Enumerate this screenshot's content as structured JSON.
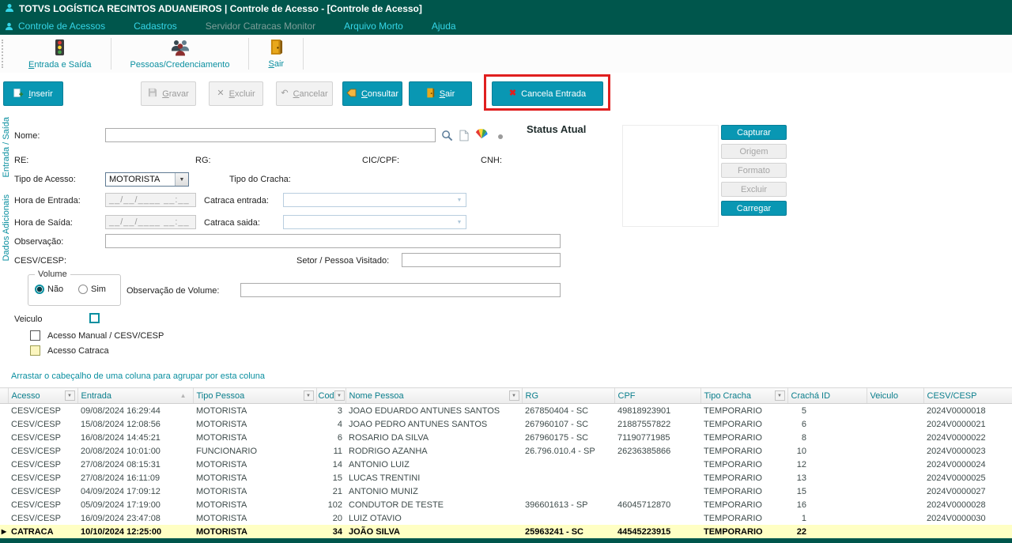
{
  "colors": {
    "titlebar": "#00564C",
    "accent_teal": "#0997B3",
    "menu_cyan": "#35D6E8",
    "highlight_row": "#FFFFC4",
    "attention_red": "#E01F1F"
  },
  "icons": {
    "filter_arrow": "▼",
    "sort_asc": "▲",
    "row_marker": "▶",
    "dropdown_arrow": "▼",
    "excluir_glyph": "✕",
    "cancelar_glyph": "↶",
    "cancela_entrada_glyph": "✖"
  },
  "title_bar": {
    "title": "TOTVS LOGÍSTICA RECINTOS ADUANEIROS | Controle de Acesso - [Controle de Acesso]"
  },
  "menu": {
    "items": [
      {
        "label": "Controle de Acessos"
      },
      {
        "label": "Cadastros"
      },
      {
        "label": "Servidor Catracas Monitor"
      },
      {
        "label": "Arquivo Morto"
      },
      {
        "label": "Ajuda"
      }
    ]
  },
  "toolbar": {
    "entrada_saida": "Entrada e Saída",
    "pessoas": "Pessoas/Credenciamento",
    "sair": "Sair"
  },
  "actions": {
    "inserir": "Inserir",
    "gravar": "Gravar",
    "excluir": "Excluir",
    "cancelar": "Cancelar",
    "consultar": "Consultar",
    "sair": "Sair",
    "cancela_entrada": "Cancela Entrada"
  },
  "side_tabs": {
    "tab1": "Entrada / Saída",
    "tab2": "Dados Adicionais"
  },
  "form": {
    "nome_label": "Nome:",
    "re_label": "RE:",
    "rg_label": "RG:",
    "cic_label": "CIC/CPF:",
    "cnh_label": "CNH:",
    "tipo_acesso_label": "Tipo de Acesso:",
    "tipo_acesso_value": "MOTORISTA",
    "tipo_cracha_label": "Tipo do Cracha:",
    "hora_entrada_label": "Hora de Entrada:",
    "hora_entrada_value": "__/__/____ __:__",
    "catraca_entrada_label": "Catraca entrada:",
    "hora_saida_label": "Hora de Saída:",
    "hora_saida_value": "__/__/____ __:__",
    "catraca_saida_label": "Catraca saida:",
    "observacao_label": "Observação:",
    "cesv_label": "CESV/CESP:",
    "setor_label": "Setor / Pessoa Visitado:",
    "status_atual": "Status Atual",
    "volume": {
      "legend": "Volume",
      "nao": "Não",
      "sim": "Sim",
      "obs_label": "Observação de Volume:"
    },
    "veiculo_label": "Veiculo",
    "acesso_manual_label": "Acesso Manual / CESV/CESP",
    "acesso_catraca_label": "Acesso Catraca"
  },
  "photo_panel": {
    "capturar": "Capturar",
    "origem": "Origem",
    "formato": "Formato",
    "excluir": "Excluir",
    "carregar": "Carregar"
  },
  "grid": {
    "group_hint": "Arrastar o cabeçalho de uma coluna para agrupar por esta coluna",
    "columns": [
      "Acesso",
      "Entrada",
      "Tipo Pessoa",
      "Cod.",
      "Nome Pessoa",
      "RG",
      "CPF",
      "Tipo Cracha",
      "Crachá ID",
      "Veiculo",
      "CESV/CESP"
    ],
    "rows": [
      {
        "acesso": "CESV/CESP",
        "entrada": "09/08/2024 16:29:44",
        "tipo_pessoa": "MOTORISTA",
        "cod": "3",
        "nome": "JOAO EDUARDO ANTUNES SANTOS",
        "rg": "267850404 - SC",
        "cpf": "49818923901",
        "tipo_cracha": "TEMPORARIO",
        "cracha_id": "5",
        "veiculo": "",
        "cesv": "2024V0000018"
      },
      {
        "acesso": "CESV/CESP",
        "entrada": "15/08/2024 12:08:56",
        "tipo_pessoa": "MOTORISTA",
        "cod": "4",
        "nome": "JOAO PEDRO ANTUNES SANTOS",
        "rg": "267960107 - SC",
        "cpf": "21887557822",
        "tipo_cracha": "TEMPORARIO",
        "cracha_id": "6",
        "veiculo": "",
        "cesv": "2024V0000021"
      },
      {
        "acesso": "CESV/CESP",
        "entrada": "16/08/2024 14:45:21",
        "tipo_pessoa": "MOTORISTA",
        "cod": "6",
        "nome": "ROSARIO DA SILVA",
        "rg": "267960175 - SC",
        "cpf": "71190771985",
        "tipo_cracha": "TEMPORARIO",
        "cracha_id": "8",
        "veiculo": "",
        "cesv": "2024V0000022"
      },
      {
        "acesso": "CESV/CESP",
        "entrada": "20/08/2024 10:01:00",
        "tipo_pessoa": "FUNCIONARIO",
        "cod": "11",
        "nome": "RODRIGO AZANHA",
        "rg": "26.796.010.4 - SP",
        "cpf": "26236385866",
        "tipo_cracha": "TEMPORARIO",
        "cracha_id": "10",
        "veiculo": "",
        "cesv": "2024V0000023"
      },
      {
        "acesso": "CESV/CESP",
        "entrada": "27/08/2024 08:15:31",
        "tipo_pessoa": "MOTORISTA",
        "cod": "14",
        "nome": "ANTONIO LUIZ",
        "rg": "",
        "cpf": "",
        "tipo_cracha": "TEMPORARIO",
        "cracha_id": "12",
        "veiculo": "",
        "cesv": "2024V0000024"
      },
      {
        "acesso": "CESV/CESP",
        "entrada": "27/08/2024 16:11:09",
        "tipo_pessoa": "MOTORISTA",
        "cod": "15",
        "nome": "LUCAS TRENTINI",
        "rg": "",
        "cpf": "",
        "tipo_cracha": "TEMPORARIO",
        "cracha_id": "13",
        "veiculo": "",
        "cesv": "2024V0000025"
      },
      {
        "acesso": "CESV/CESP",
        "entrada": "04/09/2024 17:09:12",
        "tipo_pessoa": "MOTORISTA",
        "cod": "21",
        "nome": "ANTONIO MUNIZ",
        "rg": "",
        "cpf": "",
        "tipo_cracha": "TEMPORARIO",
        "cracha_id": "15",
        "veiculo": "",
        "cesv": "2024V0000027"
      },
      {
        "acesso": "CESV/CESP",
        "entrada": "05/09/2024 17:19:00",
        "tipo_pessoa": "MOTORISTA",
        "cod": "102",
        "nome": "CONDUTOR DE TESTE",
        "rg": "396601613 - SP",
        "cpf": "46045712870",
        "tipo_cracha": "TEMPORARIO",
        "cracha_id": "16",
        "veiculo": "",
        "cesv": "2024V0000028"
      },
      {
        "acesso": "CESV/CESP",
        "entrada": "16/09/2024 23:47:08",
        "tipo_pessoa": "MOTORISTA",
        "cod": "20",
        "nome": "LUIZ OTAVIO",
        "rg": "",
        "cpf": "",
        "tipo_cracha": "TEMPORARIO",
        "cracha_id": "1",
        "veiculo": "",
        "cesv": "2024V0000030"
      },
      {
        "acesso": "CATRACA",
        "entrada": "10/10/2024 12:25:00",
        "tipo_pessoa": "MOTORISTA",
        "cod": "34",
        "nome": "JOÃO SILVA",
        "rg": "25963241 - SC",
        "cpf": "44545223915",
        "tipo_cracha": "TEMPORARIO",
        "cracha_id": "22",
        "veiculo": "",
        "cesv": "",
        "highlight": true
      }
    ]
  }
}
